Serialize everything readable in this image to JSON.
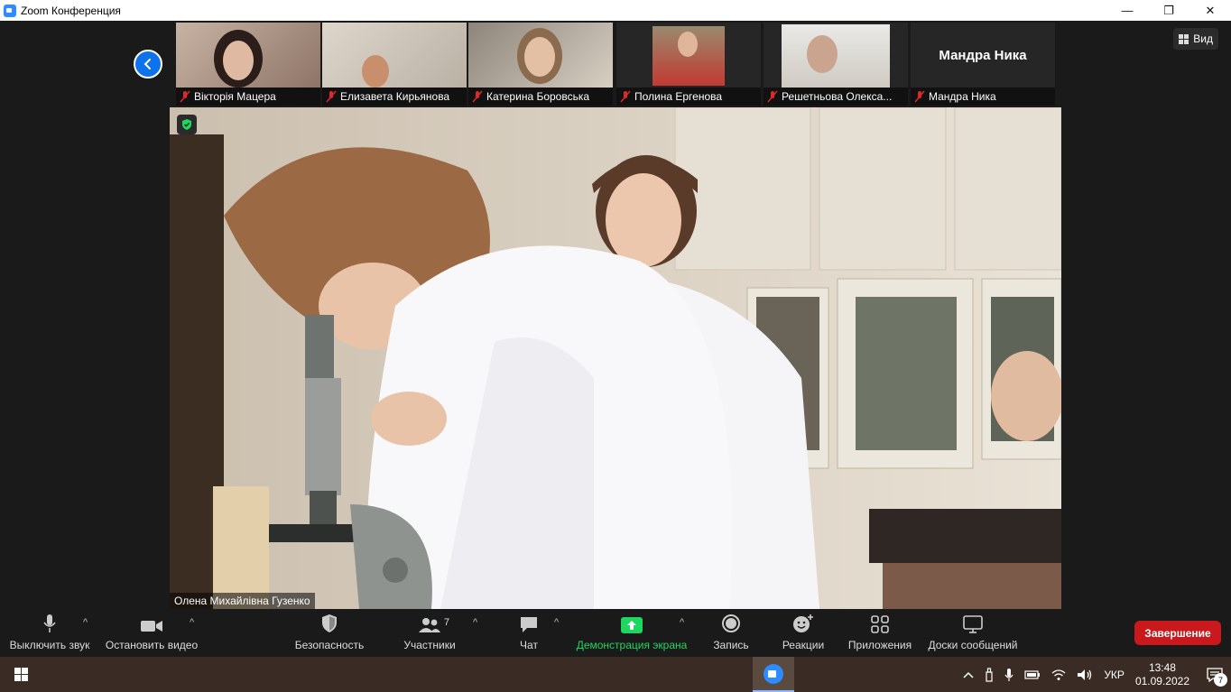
{
  "window": {
    "title": "Zoom Конференция",
    "minimize": "—",
    "restore": "❐",
    "close": "✕"
  },
  "view_button": {
    "label": "Вид"
  },
  "participants": [
    {
      "name": "Вікторія Мацера",
      "video": true
    },
    {
      "name": "Елизавета Кирьянова",
      "video": true
    },
    {
      "name": "Катерина Боровська",
      "video": true
    },
    {
      "name": "Полина Ергенова",
      "video": true
    },
    {
      "name": "Решетньова Олекса...",
      "video": true
    },
    {
      "name": "Мандра Ника",
      "video": false
    }
  ],
  "speaker": {
    "name": "Олена Михайлівна Гузенко"
  },
  "toolbar": {
    "mute": "Выключить звук",
    "stop_video": "Остановить видео",
    "security": "Безопасность",
    "participants": "Участники",
    "participants_count": "7",
    "chat": "Чат",
    "share": "Демонстрация экрана",
    "record": "Запись",
    "reactions": "Реакции",
    "apps": "Приложения",
    "whiteboards": "Доски сообщений",
    "end": "Завершение"
  },
  "taskbar": {
    "language": "УКР",
    "time": "13:48",
    "date": "01.09.2022",
    "notifications": "7"
  },
  "colors": {
    "accent": "#0e72ed",
    "share_green": "#1ed760",
    "end_red": "#c9191c",
    "muted_red": "#e02828"
  }
}
